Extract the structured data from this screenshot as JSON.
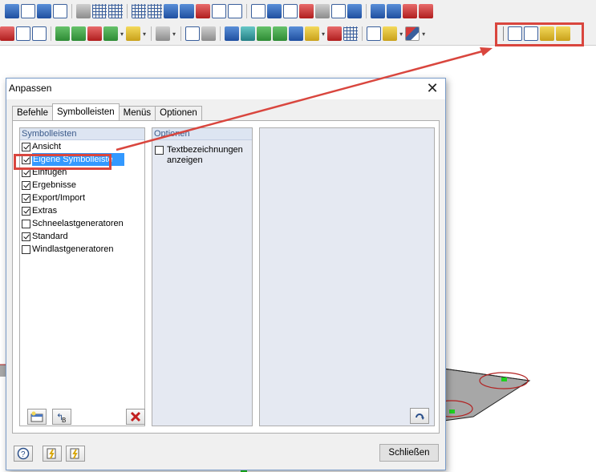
{
  "dialog": {
    "title": "Anpassen",
    "close_symbol": "✕",
    "tabs": [
      {
        "label": "Befehle",
        "active": false
      },
      {
        "label": "Symbolleisten",
        "active": true
      },
      {
        "label": "Menüs",
        "active": false
      },
      {
        "label": "Optionen",
        "active": false
      }
    ],
    "toolbars_panel": {
      "header": "Symbolleisten",
      "items": [
        {
          "label": "Ansicht",
          "checked": true,
          "selected": false
        },
        {
          "label": "Eigene Symbolleiste",
          "checked": true,
          "selected": true
        },
        {
          "label": "Einfügen",
          "checked": true,
          "selected": false
        },
        {
          "label": "Ergebnisse",
          "checked": true,
          "selected": false
        },
        {
          "label": "Export/Import",
          "checked": true,
          "selected": false
        },
        {
          "label": "Extras",
          "checked": true,
          "selected": false
        },
        {
          "label": "Schneelastgeneratoren",
          "checked": false,
          "selected": false
        },
        {
          "label": "Standard",
          "checked": true,
          "selected": false
        },
        {
          "label": "Windlastgeneratoren",
          "checked": false,
          "selected": false
        }
      ],
      "buttons": [
        "new-toolbar-icon",
        "rename-toolbar-icon",
        "delete-toolbar-icon"
      ]
    },
    "options_panel": {
      "header": "Optionen",
      "show_text_labels": {
        "label_line1": "Textbezeichnungen",
        "label_line2": "anzeigen",
        "checked": false
      }
    },
    "preview_panel": {
      "button": "reset-icon"
    },
    "footer": {
      "help_icon": "help-icon",
      "import_icon": "import-settings-icon",
      "export_icon": "export-settings-icon",
      "close_label": "Schließen"
    }
  },
  "colors": {
    "highlight": "#d9463e",
    "selection": "#3399ff",
    "panel_header_text": "#3b5a8a"
  }
}
